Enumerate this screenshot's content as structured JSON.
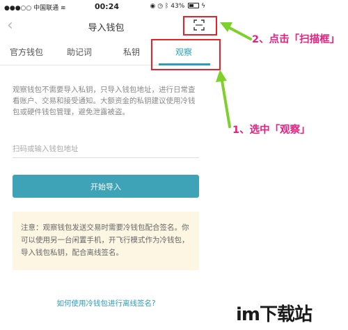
{
  "status_bar": {
    "carrier": "中国联通",
    "time": "00:24",
    "battery": "43%"
  },
  "navbar": {
    "title": "导入钱包",
    "back_icon": "chevron-left-icon",
    "scan_icon": "scan-frame-icon"
  },
  "tabs": [
    {
      "label": "官方钱包",
      "active": false
    },
    {
      "label": "助记词",
      "active": false
    },
    {
      "label": "私钥",
      "active": false
    },
    {
      "label": "观察",
      "active": true
    }
  ],
  "description": "观察钱包不需要导入私钥，只导入钱包地址，进行日常查看账户、交易和接受通知。大额资金的私钥建议使用冷钱包或硬件钱包管理，避免泄露被盗。",
  "address_input": {
    "value": "",
    "placeholder": "扫码或输入钱包地址"
  },
  "start_button": {
    "label": "开始导入"
  },
  "notice": "注意：观察钱包发送交易时需要冷钱包配合签名。你可以使用另一台闲置手机，开飞行模式作为冷钱包，导入钱包私钥，配合离线签名。",
  "help_link": {
    "label": "如何使用冷钱包进行离线签名?"
  },
  "annotations": {
    "scan": "2、点击「扫描框」",
    "watch": "1、选中「观察」"
  },
  "watermark": "im下载站",
  "colors": {
    "accent": "#3fa3b8",
    "highlight": "#e8202a",
    "annotation": "#e5207f",
    "arrow": "#7ed02a",
    "notice_bg": "#fcf6e3"
  }
}
